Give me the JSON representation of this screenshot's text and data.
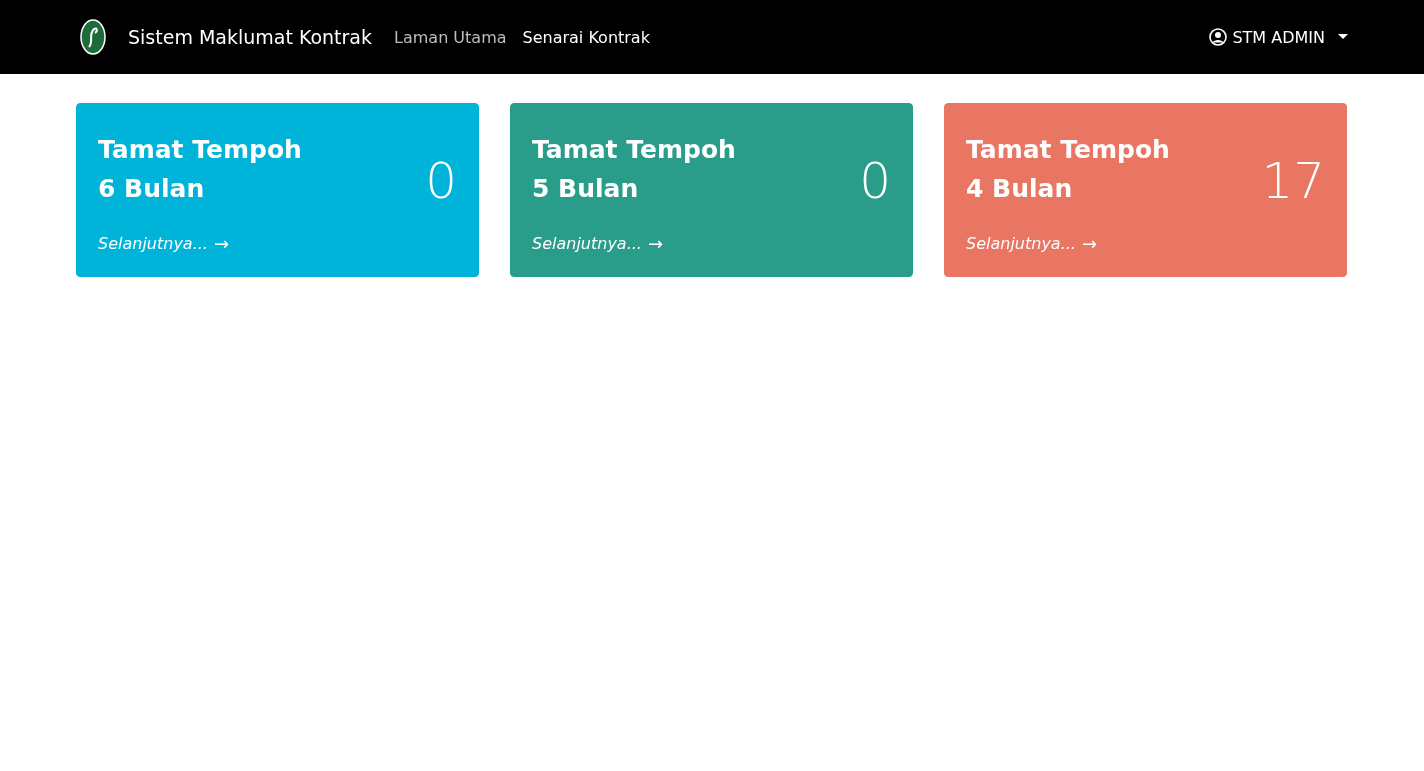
{
  "navbar": {
    "brand": "Sistem Maklumat Kontrak",
    "links": [
      {
        "label": "Laman Utama",
        "selected": false
      },
      {
        "label": "Senarai Kontrak",
        "selected": true
      }
    ],
    "user": {
      "label": "STM ADMIN"
    }
  },
  "cards": [
    {
      "title": "Tamat Tempoh",
      "period": "6 Bulan",
      "count": "0",
      "link": "Selanjutnya...",
      "arrow": "→",
      "color": "#00b3d8"
    },
    {
      "title": "Tamat Tempoh",
      "period": "5 Bulan",
      "count": "0",
      "link": "Selanjutnya...",
      "arrow": "→",
      "color": "#2a9d8a"
    },
    {
      "title": "Tamat Tempoh",
      "period": "4 Bulan",
      "count": "17",
      "link": "Selanjutnya...",
      "arrow": "→",
      "color": "#e97563"
    }
  ]
}
